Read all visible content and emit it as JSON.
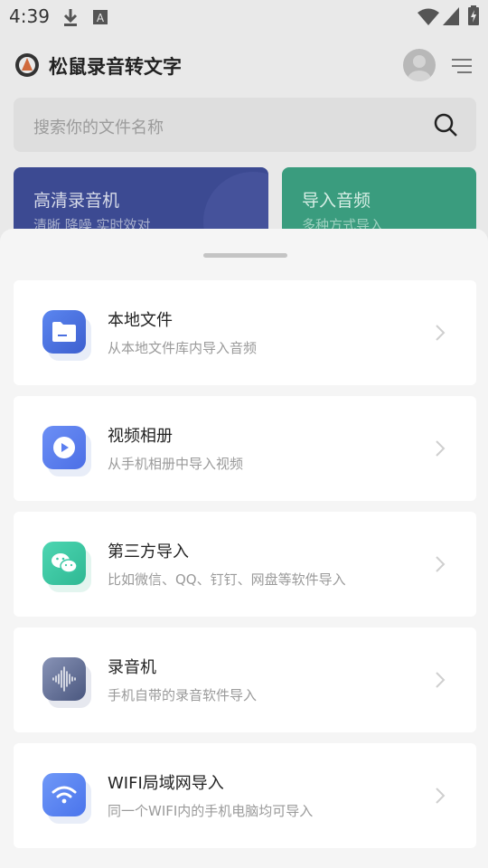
{
  "status_bar": {
    "time": "4:39",
    "icons": [
      "download-icon",
      "text-a-icon",
      "wifi-icon",
      "signal-icon",
      "battery-charging-icon"
    ]
  },
  "header": {
    "app_title": "松鼠录音转文字",
    "logo_icon": "app-logo-icon",
    "avatar_icon": "avatar-icon",
    "menu_icon": "menu-icon"
  },
  "search": {
    "placeholder": "搜索你的文件名称",
    "icon": "search-icon"
  },
  "cards": [
    {
      "title": "高清录音机",
      "subtitle": "清晰 降噪 实时效对"
    },
    {
      "title": "导入音频",
      "subtitle": "多种方式导入"
    }
  ],
  "sheet": {
    "items": [
      {
        "title": "本地文件",
        "subtitle": "从本地文件库内导入音频",
        "icon": "folder-icon",
        "color": "#4a6fe0"
      },
      {
        "title": "视频相册",
        "subtitle": "从手机相册中导入视频",
        "icon": "play-video-icon",
        "color": "#5b7ff0"
      },
      {
        "title": "第三方导入",
        "subtitle": "比如微信、QQ、钉钉、网盘等软件导入",
        "icon": "wechat-icon",
        "color": "#3cc8a4"
      },
      {
        "title": "录音机",
        "subtitle": "手机自带的录音软件导入",
        "icon": "soundwave-icon",
        "color": "#5c6b92"
      },
      {
        "title": "WIFI局域网导入",
        "subtitle": "同一个WIFI内的手机电脑均可导入",
        "icon": "wifi-icon",
        "color": "#5b86f2"
      }
    ]
  },
  "colors": {
    "sheet_bg": "#f5f5f5",
    "card_blue": "#3c4a92",
    "card_green": "#3a9c7e"
  }
}
